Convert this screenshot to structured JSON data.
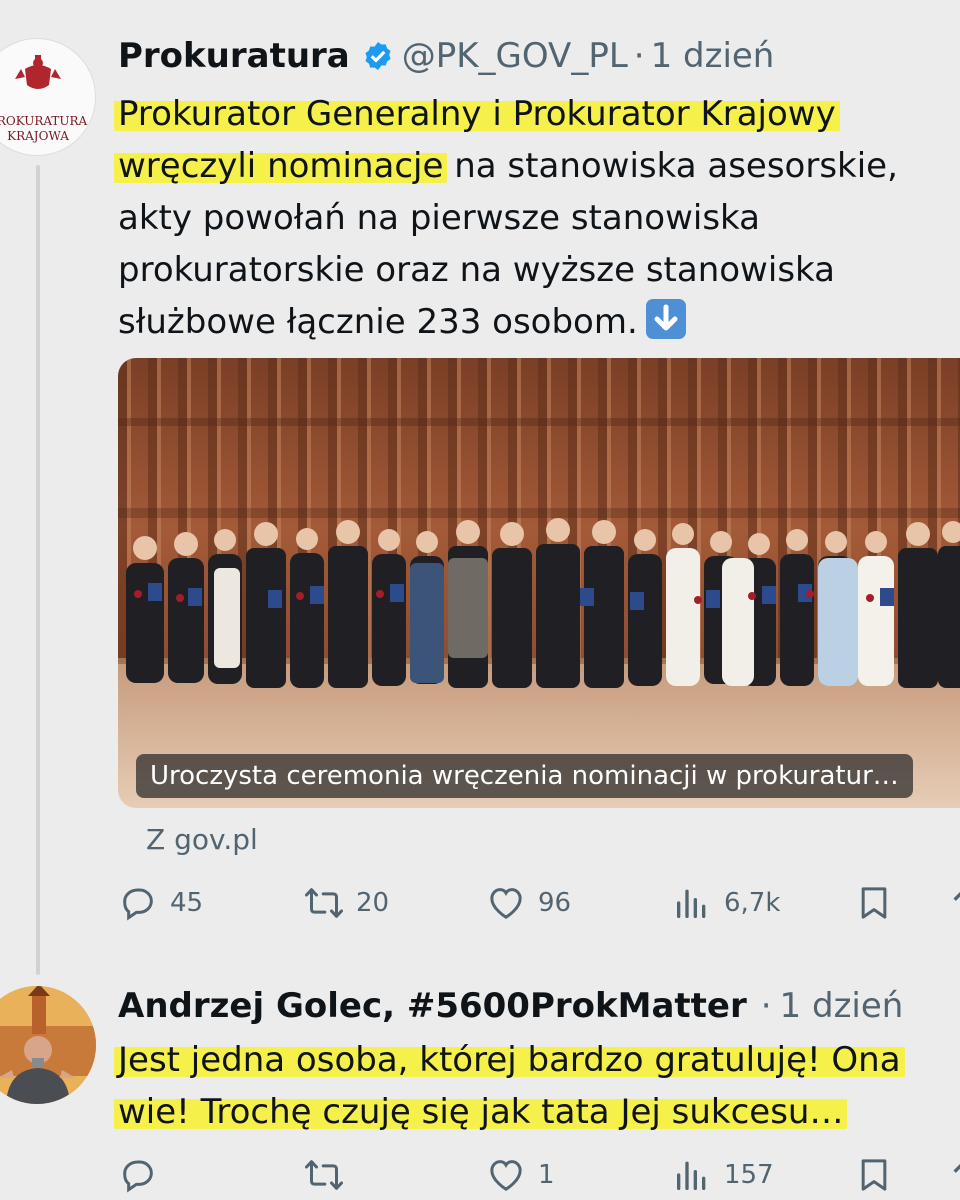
{
  "tweet1": {
    "avatar_logo_text": [
      "PROKURATURA",
      "KRAJOWA"
    ],
    "author": "Prokuratura",
    "handle": "@PK_GOV_PL",
    "separator": "·",
    "time": "1 dzień",
    "text_lines": [
      {
        "hl": "Prokurator Generalny i Prokurator Krajowy",
        "rest": ""
      },
      {
        "hl": "wręczyli nominacje",
        "rest": " na stanowiska asesorskie,"
      },
      {
        "hl": "",
        "rest": "akty powołań na pierwsze stanowiska"
      },
      {
        "hl": "",
        "rest": "prokuratorskie oraz na wyższe stanowiska"
      },
      {
        "hl": "",
        "rest": "służbowe łącznie 233 osobom."
      }
    ],
    "emoji": "down-arrow-emoji",
    "media_caption": "Uroczysta ceremonia wręczenia nominacji w prokuratur…",
    "source": "Z gov.pl",
    "replies": "45",
    "retweets": "20",
    "likes": "96",
    "views": "6,7k"
  },
  "tweet2": {
    "author": "Andrzej Golec, #5600ProkMatter",
    "separator": "·",
    "time": "1 dzień",
    "text_lines": [
      "Jest jedna osoba, której bardzo gratuluję! Ona",
      "wie! Trochę czuję się jak tata Jej sukcesu…"
    ],
    "replies": "",
    "retweets": "",
    "likes": "1",
    "views": "157"
  },
  "colors": {
    "highlight": "#f6f04a",
    "verified": "#1d9bf0",
    "muted": "#536471",
    "background": "#ececec"
  }
}
